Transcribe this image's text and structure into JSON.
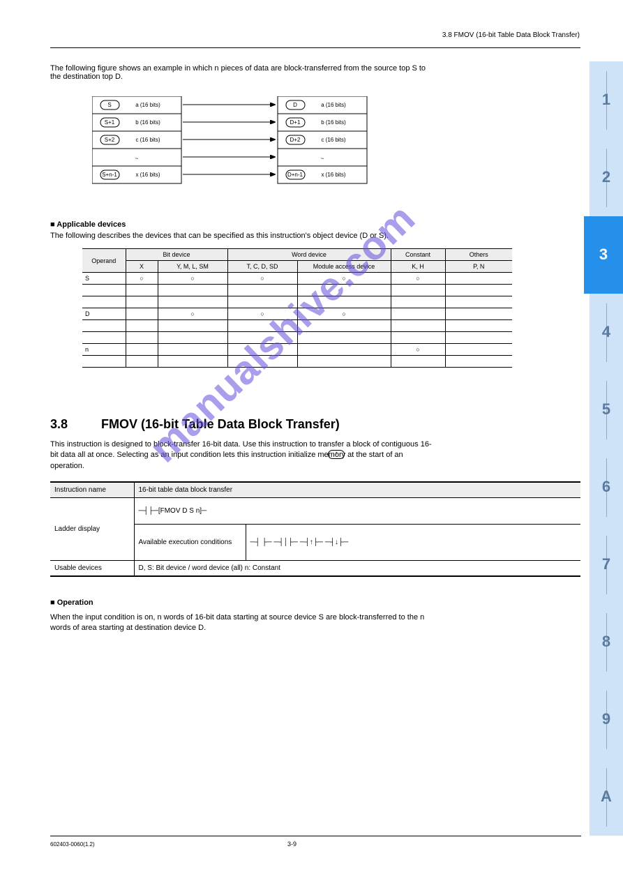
{
  "header": {
    "right": "3.8 FMOV (16-bit Table Data Block Transfer)"
  },
  "map": {
    "intro_line1": "The following figure shows an example in which n pieces of data are block-transferred from the source top S to",
    "intro_line2": "the destination top D.",
    "left": [
      "S",
      "S+1",
      "S+2",
      "~",
      "S+n-1"
    ],
    "left_labels": [
      "a (16 bits)",
      "b (16 bits)",
      "c (16 bits)",
      "",
      "x (16 bits)"
    ],
    "right": [
      "D",
      "D+1",
      "D+2",
      "~",
      "D+n-1"
    ],
    "right_labels": [
      "a (16 bits)",
      "b (16 bits)",
      "c (16 bits)",
      "",
      "x (16 bits)"
    ]
  },
  "supported": {
    "title": "■  Applicable devices",
    "sub": "The following describes the devices that can be specified as this instruction's object device (D or S).",
    "head": [
      "Operand",
      "Bit device",
      "",
      "Word device",
      "",
      "Constant",
      "Others"
    ],
    "sub_head": [
      "",
      "X",
      "Y, M, L, SM",
      "T, C, D, SD",
      "Module access device",
      "K, H",
      "P, N"
    ],
    "rows": [
      [
        "S",
        "○",
        "○",
        "○",
        "○",
        "○",
        ""
      ],
      [
        "D",
        "",
        "○",
        "○",
        "○",
        "",
        ""
      ],
      [
        "n",
        "",
        "",
        "",
        "",
        "○",
        ""
      ]
    ]
  },
  "section": {
    "num": "3.8",
    "title": "FMOV (16-bit Table Data Block Transfer)",
    "sub_line1": "This instruction is designed to block-transfer 16-bit data.  Use this instruction to transfer a block of contiguous 16-",
    "sub_line2": "bit data all at once.  Selecting      as an input condition lets this instruction initialize memory at the start of an",
    "sub_line3": "operation."
  },
  "fmov_table": {
    "header_left": "Instruction name",
    "header_right": "16-bit table data block transfer",
    "cells": [
      [
        "Ladder display",
        "─┤├─[FMOV  D  S  n]─",
        ""
      ],
      [
        "",
        "Available execution conditions",
        "─┤ ├─  ─┤│├─  ─┤↑├─  ─┤↓├─"
      ],
      [
        "Usable devices",
        "D, S: Bit device / word device (all)      n: Constant",
        ""
      ]
    ],
    "operation_head": "■  Operation",
    "operation1": "When the input condition is on, n words of 16-bit data starting at source device S are block-transferred to the n",
    "operation2": "words of area starting at destination device D."
  },
  "footer": {
    "left": "602403-0060(1.2)",
    "center": "3-9"
  },
  "tabs": {
    "active_index": 2,
    "items": [
      "1",
      "2",
      "3",
      "4",
      "5",
      "6",
      "7",
      "8",
      "9",
      "A"
    ]
  },
  "watermark_text": "manualshive.com"
}
